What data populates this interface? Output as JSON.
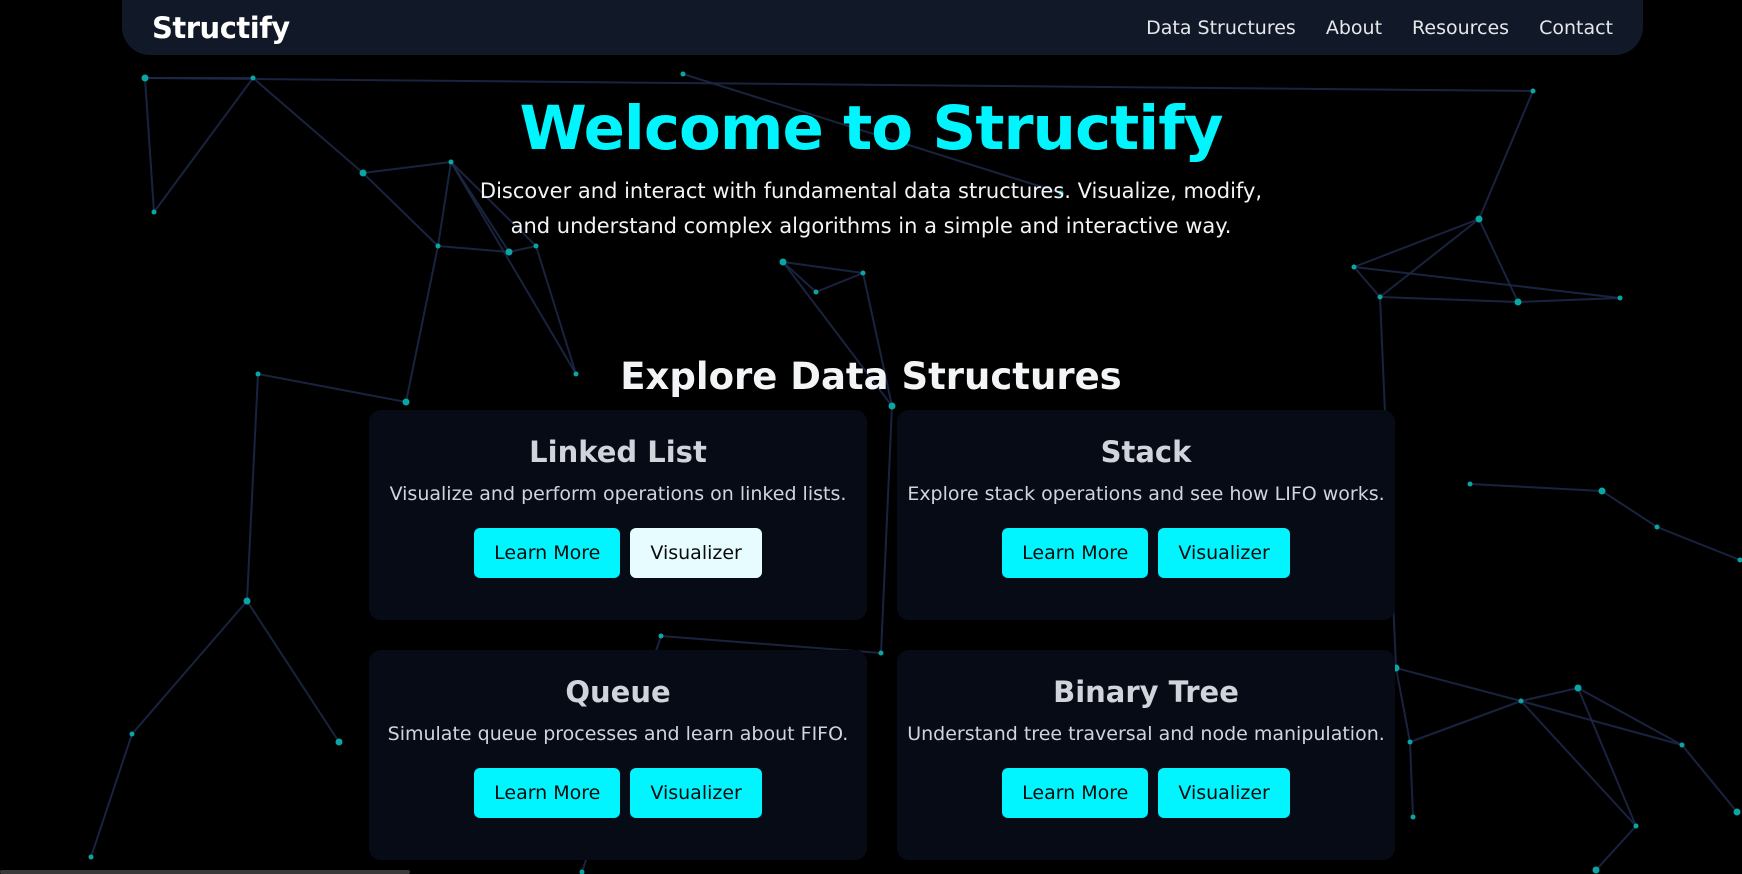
{
  "navbar": {
    "brand": "Structify",
    "links": [
      "Data Structures",
      "About",
      "Resources",
      "Contact"
    ]
  },
  "hero": {
    "title": "Welcome to Structify",
    "subtitle": "Discover and interact with fundamental data structures. Visualize, modify, and understand complex algorithms in a simple and interactive way."
  },
  "section": {
    "title": "Explore Data Structures"
  },
  "cards": [
    {
      "title": "Linked List",
      "description": "Visualize and perform operations on linked lists.",
      "learn_label": "Learn More",
      "visualizer_label": "Visualizer"
    },
    {
      "title": "Stack",
      "description": "Explore stack operations and see how LIFO works.",
      "learn_label": "Learn More",
      "visualizer_label": "Visualizer"
    },
    {
      "title": "Queue",
      "description": "Simulate queue processes and learn about FIFO.",
      "learn_label": "Learn More",
      "visualizer_label": "Visualizer"
    },
    {
      "title": "Binary Tree",
      "description": "Understand tree traversal and node manipulation.",
      "learn_label": "Learn More",
      "visualizer_label": "Visualizer"
    }
  ],
  "colors": {
    "accent": "#00f5ff",
    "background": "#000000",
    "navbar": "#111827",
    "card": "#060b16",
    "node": "#0aa5a5",
    "edge": "#1e2a4a",
    "hover_button": "#e6fcff"
  }
}
